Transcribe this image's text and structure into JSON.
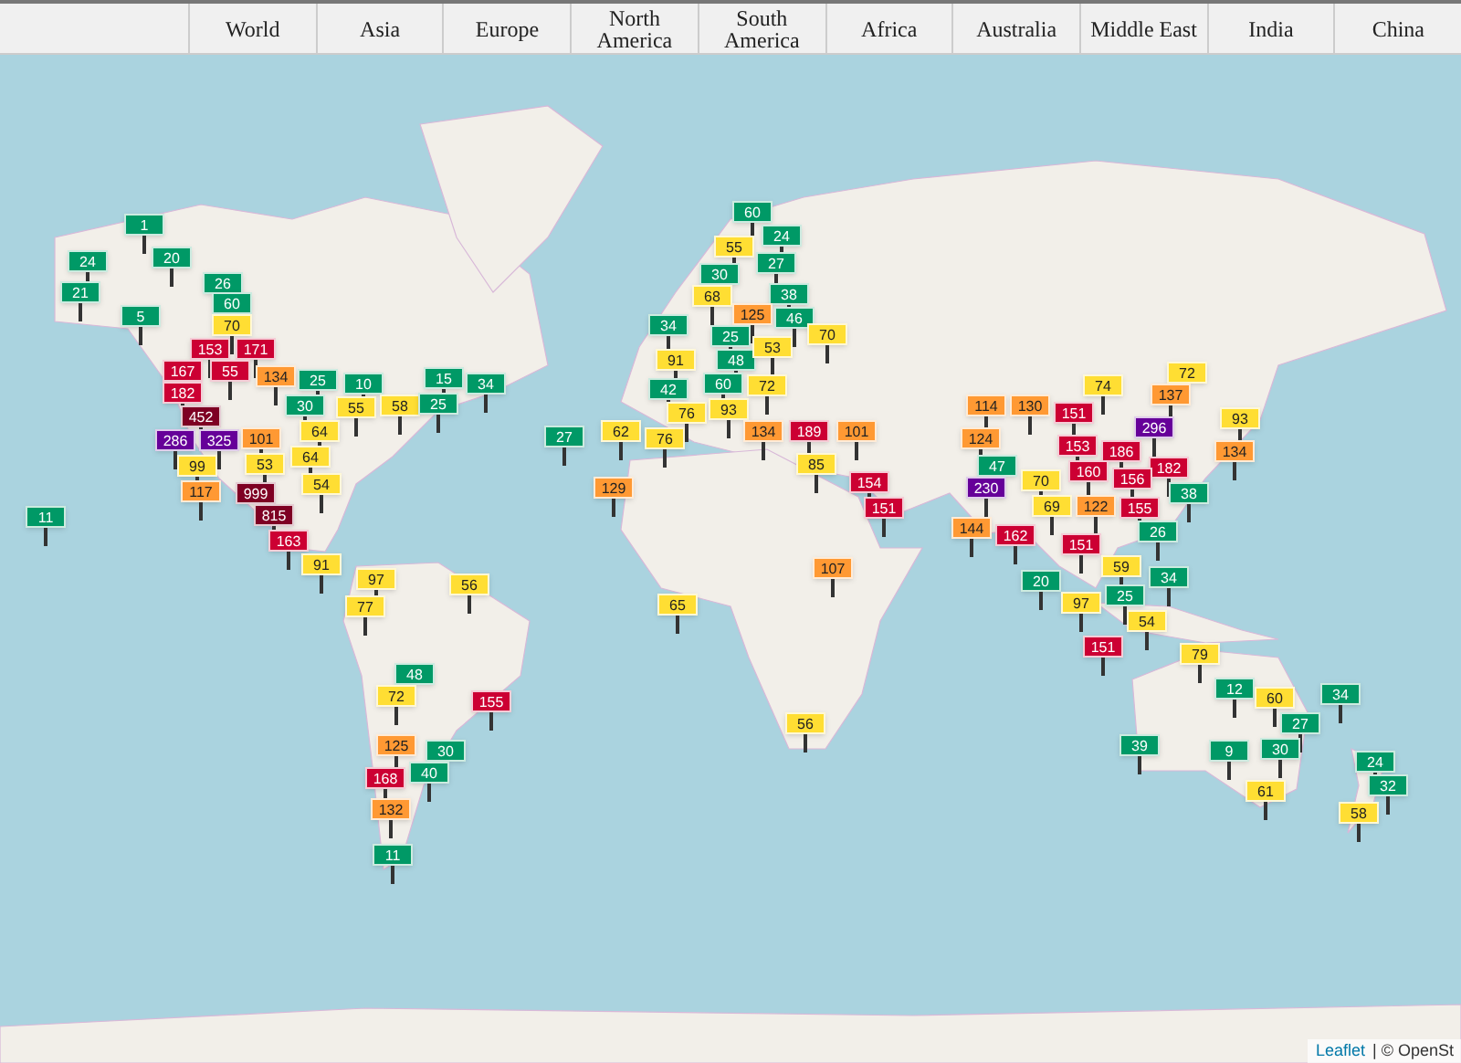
{
  "tabs": [
    {
      "label": "World"
    },
    {
      "label": "Asia"
    },
    {
      "label": "Europe"
    },
    {
      "label": "North America"
    },
    {
      "label": "South America"
    },
    {
      "label": "Africa"
    },
    {
      "label": "Australia"
    },
    {
      "label": "Middle East"
    },
    {
      "label": "India"
    },
    {
      "label": "China"
    }
  ],
  "markers": [
    {
      "value": "1",
      "color": "#009966"
    },
    {
      "value": "24",
      "color": "#009966"
    },
    {
      "value": "20",
      "color": "#009966"
    },
    {
      "value": "21",
      "color": "#009966"
    },
    {
      "value": "26",
      "color": "#009966"
    },
    {
      "value": "5",
      "color": "#009966"
    },
    {
      "value": "60",
      "color": "#009966"
    },
    {
      "value": "70",
      "color": "#ffde33"
    },
    {
      "value": "153",
      "color": "#cc0033"
    },
    {
      "value": "171",
      "color": "#cc0033"
    },
    {
      "value": "167",
      "color": "#cc0033"
    },
    {
      "value": "55",
      "color": "#cc0033"
    },
    {
      "value": "182",
      "color": "#cc0033"
    },
    {
      "value": "134",
      "color": "#ff9933"
    },
    {
      "value": "452",
      "color": "#7e0023"
    },
    {
      "value": "25",
      "color": "#009966"
    },
    {
      "value": "10",
      "color": "#009966"
    },
    {
      "value": "55",
      "color": "#ffde33"
    },
    {
      "value": "58",
      "color": "#ffde33"
    },
    {
      "value": "15",
      "color": "#009966"
    },
    {
      "value": "34",
      "color": "#009966"
    },
    {
      "value": "30",
      "color": "#009966"
    },
    {
      "value": "25",
      "color": "#009966"
    },
    {
      "value": "286",
      "color": "#660099"
    },
    {
      "value": "325",
      "color": "#660099"
    },
    {
      "value": "101",
      "color": "#ff9933"
    },
    {
      "value": "64",
      "color": "#ffde33"
    },
    {
      "value": "99",
      "color": "#ffde33"
    },
    {
      "value": "53",
      "color": "#ffde33"
    },
    {
      "value": "64",
      "color": "#ffde33"
    },
    {
      "value": "117",
      "color": "#ff9933"
    },
    {
      "value": "999",
      "color": "#7e0023"
    },
    {
      "value": "54",
      "color": "#ffde33"
    },
    {
      "value": "815",
      "color": "#7e0023"
    },
    {
      "value": "163",
      "color": "#cc0033"
    },
    {
      "value": "11",
      "color": "#009966"
    },
    {
      "value": "91",
      "color": "#ffde33"
    },
    {
      "value": "60",
      "color": "#009966"
    },
    {
      "value": "24",
      "color": "#009966"
    },
    {
      "value": "55",
      "color": "#ffde33"
    },
    {
      "value": "27",
      "color": "#009966"
    },
    {
      "value": "30",
      "color": "#009966"
    },
    {
      "value": "68",
      "color": "#ffde33"
    },
    {
      "value": "38",
      "color": "#009966"
    },
    {
      "value": "125",
      "color": "#ff9933"
    },
    {
      "value": "46",
      "color": "#009966"
    },
    {
      "value": "34",
      "color": "#009966"
    },
    {
      "value": "70",
      "color": "#ffde33"
    },
    {
      "value": "25",
      "color": "#009966"
    },
    {
      "value": "91",
      "color": "#ffde33"
    },
    {
      "value": "48",
      "color": "#009966"
    },
    {
      "value": "53",
      "color": "#ffde33"
    },
    {
      "value": "42",
      "color": "#009966"
    },
    {
      "value": "60",
      "color": "#009966"
    },
    {
      "value": "72",
      "color": "#ffde33"
    },
    {
      "value": "76",
      "color": "#ffde33"
    },
    {
      "value": "93",
      "color": "#ffde33"
    },
    {
      "value": "27",
      "color": "#009966"
    },
    {
      "value": "62",
      "color": "#ffde33"
    },
    {
      "value": "76",
      "color": "#ffde33"
    },
    {
      "value": "134",
      "color": "#ff9933"
    },
    {
      "value": "189",
      "color": "#cc0033"
    },
    {
      "value": "101",
      "color": "#ff9933"
    },
    {
      "value": "85",
      "color": "#ffde33"
    },
    {
      "value": "129",
      "color": "#ff9933"
    },
    {
      "value": "154",
      "color": "#cc0033"
    },
    {
      "value": "151",
      "color": "#cc0033"
    },
    {
      "value": "72",
      "color": "#ffde33"
    },
    {
      "value": "74",
      "color": "#ffde33"
    },
    {
      "value": "137",
      "color": "#ff9933"
    },
    {
      "value": "114",
      "color": "#ff9933"
    },
    {
      "value": "130",
      "color": "#ff9933"
    },
    {
      "value": "151",
      "color": "#cc0033"
    },
    {
      "value": "296",
      "color": "#660099"
    },
    {
      "value": "93",
      "color": "#ffde33"
    },
    {
      "value": "124",
      "color": "#ff9933"
    },
    {
      "value": "153",
      "color": "#cc0033"
    },
    {
      "value": "186",
      "color": "#cc0033"
    },
    {
      "value": "134",
      "color": "#ff9933"
    },
    {
      "value": "47",
      "color": "#009966"
    },
    {
      "value": "160",
      "color": "#cc0033"
    },
    {
      "value": "182",
      "color": "#cc0033"
    },
    {
      "value": "230",
      "color": "#660099"
    },
    {
      "value": "70",
      "color": "#ffde33"
    },
    {
      "value": "156",
      "color": "#cc0033"
    },
    {
      "value": "38",
      "color": "#009966"
    },
    {
      "value": "69",
      "color": "#ffde33"
    },
    {
      "value": "122",
      "color": "#ff9933"
    },
    {
      "value": "155",
      "color": "#cc0033"
    },
    {
      "value": "144",
      "color": "#ff9933"
    },
    {
      "value": "162",
      "color": "#cc0033"
    },
    {
      "value": "26",
      "color": "#009966"
    },
    {
      "value": "151",
      "color": "#cc0033"
    },
    {
      "value": "59",
      "color": "#ffde33"
    },
    {
      "value": "20",
      "color": "#009966"
    },
    {
      "value": "34",
      "color": "#009966"
    },
    {
      "value": "97",
      "color": "#ffde33"
    },
    {
      "value": "25",
      "color": "#009966"
    },
    {
      "value": "54",
      "color": "#ffde33"
    },
    {
      "value": "151",
      "color": "#cc0033"
    },
    {
      "value": "97",
      "color": "#ffde33"
    },
    {
      "value": "56",
      "color": "#ffde33"
    },
    {
      "value": "77",
      "color": "#ffde33"
    },
    {
      "value": "107",
      "color": "#ff9933"
    },
    {
      "value": "65",
      "color": "#ffde33"
    },
    {
      "value": "48",
      "color": "#009966"
    },
    {
      "value": "72",
      "color": "#ffde33"
    },
    {
      "value": "155",
      "color": "#cc0033"
    },
    {
      "value": "125",
      "color": "#ff9933"
    },
    {
      "value": "30",
      "color": "#009966"
    },
    {
      "value": "168",
      "color": "#cc0033"
    },
    {
      "value": "40",
      "color": "#009966"
    },
    {
      "value": "132",
      "color": "#ff9933"
    },
    {
      "value": "56",
      "color": "#ffde33"
    },
    {
      "value": "11",
      "color": "#009966"
    },
    {
      "value": "79",
      "color": "#ffde33"
    },
    {
      "value": "12",
      "color": "#009966"
    },
    {
      "value": "60",
      "color": "#ffde33"
    },
    {
      "value": "27",
      "color": "#009966"
    },
    {
      "value": "34",
      "color": "#009966"
    },
    {
      "value": "39",
      "color": "#009966"
    },
    {
      "value": "9",
      "color": "#009966"
    },
    {
      "value": "30",
      "color": "#009966"
    },
    {
      "value": "24",
      "color": "#009966"
    },
    {
      "value": "61",
      "color": "#ffde33"
    },
    {
      "value": "32",
      "color": "#009966"
    },
    {
      "value": "58",
      "color": "#ffde33"
    }
  ],
  "attribution": {
    "link": "Leaflet",
    "text": "| © OpenSt"
  }
}
